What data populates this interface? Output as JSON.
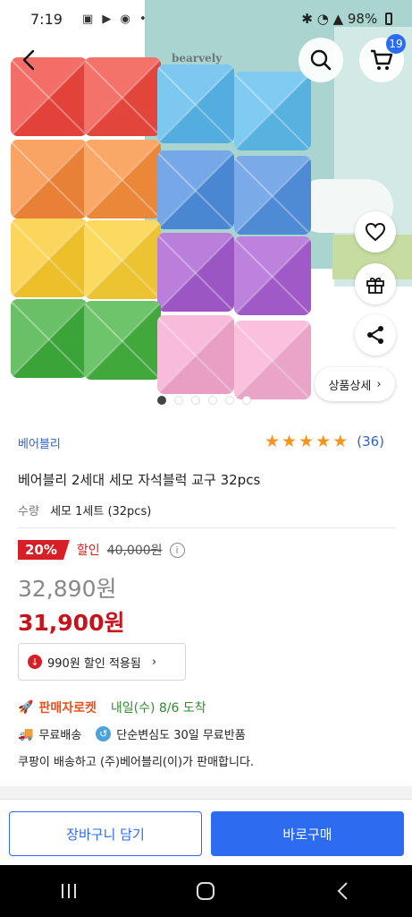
{
  "status_bar": {
    "time": "7:19",
    "battery": "98%"
  },
  "hero": {
    "box_brand": "bearvely",
    "cart_count": "19",
    "detail_button": "상품상세",
    "image_count": 6,
    "active_image": 1
  },
  "product": {
    "brand": "베어블리",
    "rating_stars": 5,
    "review_count": "(36)",
    "title": "베어블리 2세대 세모 자석블럭 교구 32pcs",
    "quantity_label": "수량",
    "quantity_value": "세모 1세트 (32pcs)",
    "discount_percent": "20%",
    "discount_label": "할인",
    "original_price": "40,000원",
    "sale_price": "32,890원",
    "final_price": "31,900원",
    "coupon_text": "990원  할인 적용됨"
  },
  "delivery": {
    "rocket_label": "판매자로켓",
    "delivery_date": "내일(수) 8/6 도착",
    "free_shipping": "무료배송",
    "free_return": "단순변심도 30일 무료반품",
    "seller_note": "쿠팡이 배송하고 (주)베어블리(이)가 판매합니다."
  },
  "actions": {
    "add_to_cart": "장바구니 담기",
    "buy_now": "바로구매"
  },
  "colors": {
    "accent_blue": "#2d6bf0",
    "price_red": "#c8131c",
    "star_orange": "#f7941e"
  }
}
